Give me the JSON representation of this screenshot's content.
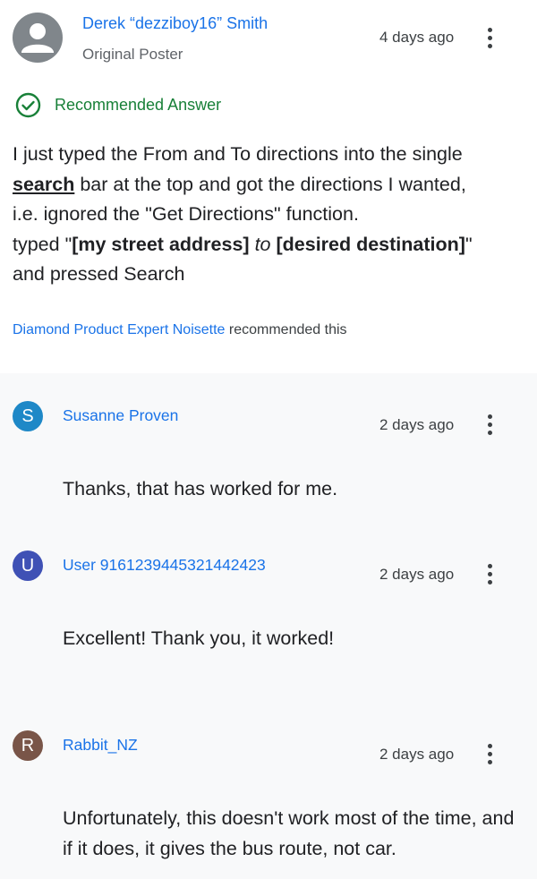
{
  "original_post": {
    "author": "Derek “dezziboy16” Smith",
    "role": "Original Poster",
    "time": "4 days ago"
  },
  "recommended_answer": {
    "badge_label": "Recommended Answer",
    "line1": "I just typed the From and To directions into the single",
    "search_word": "search",
    "line2_rest": " bar at the top and got the directions I wanted,",
    "line3": "i.e. ignored the \"Get Directions\" function.",
    "typed_prefix": "typed \"",
    "bold1": "[my street address]",
    "italic_to": "to",
    "bold2": "[desired destination]",
    "typed_suffix": "\"",
    "line5": "and pressed Search",
    "recommender_link": "Diamond Product Expert Noisette",
    "recommended_suffix": " recommended this"
  },
  "replies": [
    {
      "initial": "S",
      "avatar_color": "#1e88c7",
      "name": "Susanne Proven",
      "time": "2 days ago",
      "text": "Thanks, that has worked for me."
    },
    {
      "initial": "U",
      "avatar_color": "#3f51b5",
      "name": "User 9161239445321442423",
      "time": "2 days ago",
      "text": "Excellent! Thank you, it worked!"
    },
    {
      "initial": "R",
      "avatar_color": "#795548",
      "name": "Rabbit_NZ",
      "time": "2 days ago",
      "text": "Unfortunately, this doesn't work most of the time, and if it does, it gives the bus route, not car."
    }
  ],
  "icons": {
    "avatar": "person-avatar-icon",
    "check": "check-circle-icon",
    "more": "more-vert-icon"
  }
}
